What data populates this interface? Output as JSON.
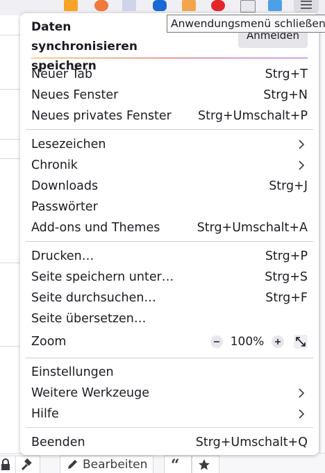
{
  "tooltip": "Anwendungsmenü schließen",
  "sync": {
    "title": "Daten synchronisieren speichern",
    "signin_label": "Anmelden"
  },
  "menu": {
    "new_tab": {
      "label": "Neuer Tab",
      "shortcut": "Strg+T"
    },
    "new_window": {
      "label": "Neues Fenster",
      "shortcut": "Strg+N"
    },
    "new_private": {
      "label": "Neues privates Fenster",
      "shortcut": "Strg+Umschalt+P"
    },
    "bookmarks": {
      "label": "Lesezeichen"
    },
    "history": {
      "label": "Chronik"
    },
    "downloads": {
      "label": "Downloads",
      "shortcut": "Strg+J"
    },
    "passwords": {
      "label": "Passwörter"
    },
    "addons": {
      "label": "Add-ons und Themes",
      "shortcut": "Strg+Umschalt+A"
    },
    "print": {
      "label": "Drucken…",
      "shortcut": "Strg+P"
    },
    "save_page": {
      "label": "Seite speichern unter…",
      "shortcut": "Strg+S"
    },
    "find": {
      "label": "Seite durchsuchen…",
      "shortcut": "Strg+F"
    },
    "translate": {
      "label": "Seite übersetzen…"
    },
    "zoom": {
      "label": "Zoom",
      "value": "100%"
    },
    "settings": {
      "label": "Einstellungen"
    },
    "more_tools": {
      "label": "Weitere Werkzeuge"
    },
    "help": {
      "label": "Hilfe"
    },
    "quit": {
      "label": "Beenden",
      "shortcut": "Strg+Umschalt+Q"
    }
  },
  "background": {
    "edit_label": "Bearbeiten"
  },
  "colors": {
    "accent_gradient": [
      "#f5a623",
      "#e2403d",
      "#9059ff"
    ],
    "menu_button_active": "#dcdce2"
  }
}
